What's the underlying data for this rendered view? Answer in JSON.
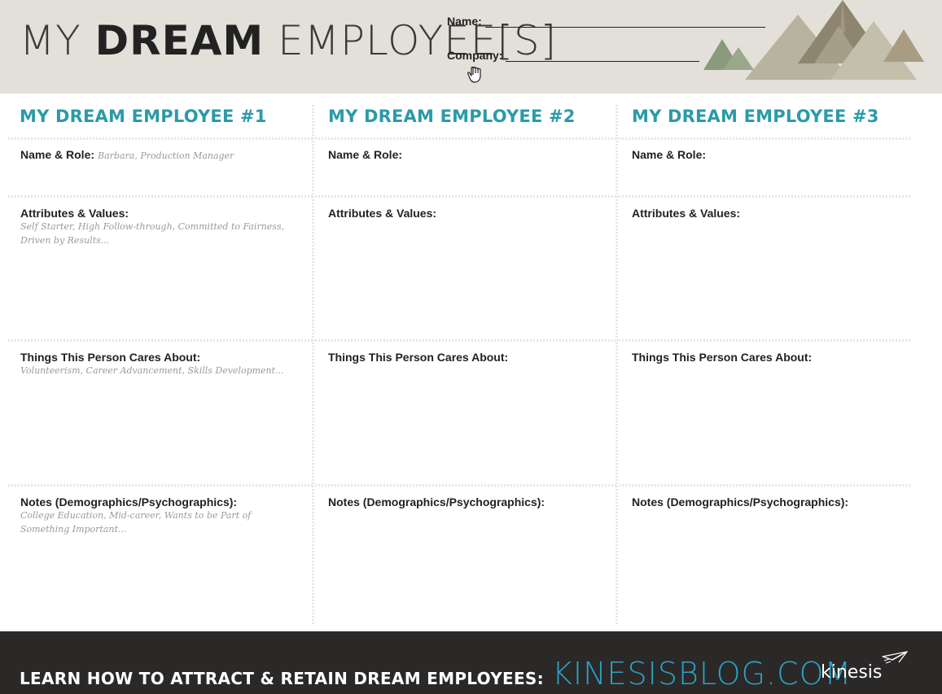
{
  "header": {
    "title_part1": "MY ",
    "title_part2": "DREAM",
    "title_part3": " EMPLOYEE[S]",
    "name_label": "Name:",
    "company_label": "Company:",
    "colors": {
      "background": "#e2e0d8",
      "accent": "#2b9aa8"
    }
  },
  "columns": [
    {
      "title": "MY DREAM EMPLOYEE #1",
      "name_role_label": "Name & Role:",
      "name_role_sample": "Barbara, Production Manager",
      "attributes_label": "Attributes & Values:",
      "attributes_sample": "Self Starter, High Follow-through, Committed to Fairness, Driven by Results...",
      "cares_label": "Things This Person Cares About:",
      "cares_sample": "Volunteerism, Career Advancement, Skills Development...",
      "notes_label": "Notes (Demographics/Psychographics):",
      "notes_sample": "College Education, Mid-career, Wants to be Part of Something Important..."
    },
    {
      "title": "MY DREAM EMPLOYEE #2",
      "name_role_label": "Name & Role:",
      "attributes_label": "Attributes & Values:",
      "cares_label": "Things This Person Cares About:",
      "notes_label": "Notes (Demographics/Psychographics):"
    },
    {
      "title": "MY DREAM EMPLOYEE #3",
      "name_role_label": "Name & Role:",
      "attributes_label": "Attributes & Values:",
      "cares_label": "Things This Person Cares About:",
      "notes_label": "Notes (Demographics/Psychographics):"
    }
  ],
  "footer": {
    "cta_text": "LEARN HOW TO ATTRACT & RETAIN DREAM EMPLOYEES:",
    "cta_link": "KINESISBLOG.COM",
    "logo_text": "kinesis",
    "colors": {
      "background": "#2b2828",
      "link": "#2aa3c4"
    }
  },
  "icons": [
    "hand-cursor-icon",
    "mountains-illustration",
    "paper-plane-icon"
  ]
}
